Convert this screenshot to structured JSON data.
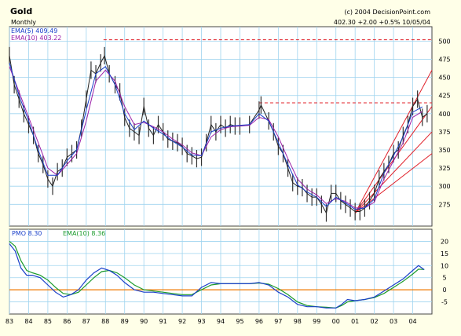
{
  "header": {
    "title": "Gold",
    "period": "Monthly",
    "copyright": "(c) 2004 DecisionPoint.com",
    "quote": "402.30 +2.00 +0.5% 10/05/04"
  },
  "chart_data": [
    {
      "type": "line",
      "name": "price-panel",
      "ylim": [
        245,
        520
      ],
      "yticks": [
        275,
        300,
        325,
        350,
        375,
        400,
        425,
        450,
        475,
        500
      ],
      "xlim": [
        1983.0,
        2005.0
      ],
      "legend": [
        {
          "label": "EMA(5) 409.49",
          "color": "#1a3fc9"
        },
        {
          "label": "EMA(10) 403.22",
          "color": "#9b1fa8"
        }
      ],
      "series": [
        {
          "name": "Gold",
          "color": "#222222",
          "x": [
            1983.0,
            1983.25,
            1983.5,
            1983.75,
            1984.0,
            1984.25,
            1984.5,
            1984.75,
            1985.0,
            1985.25,
            1985.5,
            1985.75,
            1986.0,
            1986.25,
            1986.5,
            1986.75,
            1987.0,
            1987.25,
            1987.5,
            1987.75,
            1987.95,
            1988.2,
            1988.5,
            1988.75,
            1989.0,
            1989.25,
            1989.5,
            1989.75,
            1990.0,
            1990.25,
            1990.5,
            1990.75,
            1991.0,
            1991.25,
            1991.5,
            1991.75,
            1992.0,
            1992.25,
            1992.5,
            1992.75,
            1993.0,
            1993.25,
            1993.5,
            1993.75,
            1994.0,
            1994.25,
            1994.5,
            1994.75,
            1995.0,
            1995.5,
            1996.0,
            1996.1,
            1996.5,
            1996.75,
            1997.0,
            1997.25,
            1997.5,
            1997.75,
            1998.0,
            1998.25,
            1998.5,
            1998.75,
            1999.0,
            1999.25,
            1999.5,
            1999.75,
            2000.0,
            2000.25,
            2000.5,
            2000.75,
            2001.0,
            2001.25,
            2001.5,
            2001.75,
            2002.0,
            2002.25,
            2002.5,
            2002.75,
            2003.0,
            2003.25,
            2003.5,
            2003.75,
            2004.0,
            2004.25,
            2004.5,
            2004.75
          ],
          "y": [
            480,
            440,
            420,
            400,
            385,
            370,
            345,
            330,
            310,
            300,
            320,
            325,
            340,
            345,
            350,
            380,
            420,
            460,
            455,
            470,
            480,
            455,
            440,
            430,
            395,
            380,
            375,
            370,
            410,
            380,
            370,
            385,
            375,
            365,
            362,
            360,
            355,
            345,
            342,
            338,
            340,
            360,
            385,
            375,
            385,
            380,
            385,
            383,
            383,
            385,
            405,
            412,
            390,
            375,
            355,
            345,
            325,
            305,
            300,
            298,
            290,
            285,
            285,
            275,
            263,
            290,
            290,
            280,
            275,
            270,
            265,
            265,
            270,
            280,
            290,
            310,
            320,
            330,
            345,
            350,
            370,
            385,
            410,
            420,
            395,
            400
          ]
        },
        {
          "name": "EMA(5)",
          "color": "#1a3fc9",
          "x": [
            1983.0,
            1983.5,
            1984.0,
            1984.5,
            1985.0,
            1985.5,
            1986.0,
            1986.5,
            1987.0,
            1987.5,
            1988.0,
            1988.5,
            1989.0,
            1989.5,
            1990.0,
            1990.5,
            1991.0,
            1991.5,
            1992.0,
            1992.5,
            1993.0,
            1993.5,
            1994.0,
            1994.5,
            1995.0,
            1995.5,
            1996.0,
            1996.5,
            1997.0,
            1997.5,
            1998.0,
            1998.5,
            1999.0,
            1999.5,
            2000.0,
            2000.5,
            2001.0,
            2001.5,
            2002.0,
            2002.5,
            2003.0,
            2003.5,
            2004.0,
            2004.5
          ],
          "y": [
            470,
            425,
            390,
            350,
            315,
            315,
            335,
            350,
            405,
            455,
            465,
            440,
            400,
            378,
            390,
            380,
            372,
            362,
            354,
            343,
            342,
            375,
            380,
            383,
            384,
            385,
            400,
            390,
            360,
            330,
            302,
            292,
            285,
            272,
            285,
            277,
            268,
            270,
            282,
            318,
            342,
            368,
            402,
            409.49
          ]
        },
        {
          "name": "EMA(10)",
          "color": "#9b1fa8",
          "x": [
            1983.0,
            1983.5,
            1984.0,
            1984.5,
            1985.0,
            1985.5,
            1986.0,
            1986.5,
            1987.0,
            1987.5,
            1988.0,
            1988.5,
            1989.0,
            1989.5,
            1990.0,
            1990.5,
            1991.0,
            1991.5,
            1992.0,
            1992.5,
            1993.0,
            1993.5,
            1994.0,
            1994.5,
            1995.0,
            1995.5,
            1996.0,
            1996.5,
            1997.0,
            1997.5,
            1998.0,
            1998.5,
            1999.0,
            1999.5,
            2000.0,
            2000.5,
            2001.0,
            2001.5,
            2002.0,
            2002.5,
            2003.0,
            2003.5,
            2004.0,
            2004.5
          ],
          "y": [
            465,
            430,
            395,
            360,
            325,
            315,
            330,
            345,
            390,
            445,
            460,
            445,
            410,
            385,
            388,
            382,
            375,
            365,
            357,
            346,
            342,
            368,
            378,
            382,
            383,
            384,
            395,
            392,
            368,
            338,
            310,
            296,
            288,
            276,
            283,
            279,
            270,
            270,
            278,
            310,
            335,
            360,
            395,
            403.22
          ]
        }
      ],
      "reference_lines": [
        {
          "kind": "horizontal-dashed",
          "color": "#e0202a",
          "y": 502,
          "x_from": 1987.9
        },
        {
          "kind": "horizontal-dashed",
          "color": "#e0202a",
          "y": 415,
          "x_from": 1996.0
        },
        {
          "kind": "trendline",
          "color": "#e0202a",
          "x": [
            2001.0,
            2005.0
          ],
          "y": [
            263,
            460
          ]
        },
        {
          "kind": "trendline",
          "color": "#e0202a",
          "x": [
            2001.0,
            2005.0
          ],
          "y": [
            263,
            410
          ]
        },
        {
          "kind": "trendline",
          "color": "#e0202a",
          "x": [
            2001.0,
            2005.0
          ],
          "y": [
            263,
            375
          ]
        },
        {
          "kind": "trendline",
          "color": "#e0202a",
          "x": [
            2001.0,
            2005.0
          ],
          "y": [
            263,
            345
          ]
        }
      ]
    },
    {
      "type": "line",
      "name": "pmo-panel",
      "ylim": [
        -10,
        25
      ],
      "yticks": [
        -5,
        0,
        5,
        10,
        15,
        20
      ],
      "zero_line_color": "#f07800",
      "xlim": [
        1983.0,
        2005.0
      ],
      "legend": [
        {
          "label": "PMO 8.30",
          "color": "#1a3fc9"
        },
        {
          "label": "EMA(10) 8.36",
          "color": "#1a9a2a"
        }
      ],
      "series": [
        {
          "name": "PMO",
          "color": "#1a3fc9",
          "x": [
            1983.0,
            1983.3,
            1983.6,
            1983.9,
            1984.2,
            1984.6,
            1985.0,
            1985.4,
            1985.8,
            1986.2,
            1986.6,
            1987.0,
            1987.4,
            1987.8,
            1988.2,
            1988.6,
            1989.0,
            1989.5,
            1990.0,
            1990.5,
            1991.0,
            1991.5,
            1992.0,
            1992.5,
            1993.0,
            1993.5,
            1994.0,
            1994.5,
            1995.0,
            1995.5,
            1996.0,
            1996.5,
            1997.0,
            1997.5,
            1998.0,
            1998.5,
            1999.0,
            1999.5,
            2000.0,
            2000.3,
            2000.6,
            2001.0,
            2001.5,
            2002.0,
            2002.5,
            2003.0,
            2003.5,
            2004.0,
            2004.3,
            2004.6
          ],
          "y": [
            19,
            16,
            9,
            6,
            6,
            5,
            2,
            -1,
            -3,
            -2,
            0,
            4,
            7,
            9,
            8,
            6,
            3,
            0,
            -1,
            -1,
            -1.5,
            -2,
            -2.5,
            -2.5,
            1,
            3,
            2.5,
            2.5,
            2.5,
            2.5,
            3,
            2,
            -1,
            -3,
            -6,
            -7,
            -7,
            -7.5,
            -7.5,
            -6,
            -4,
            -4.5,
            -4,
            -3,
            -0.5,
            2,
            4.5,
            8,
            10,
            8.3
          ]
        },
        {
          "name": "EMA(10)",
          "color": "#1a9a2a",
          "x": [
            1983.0,
            1983.3,
            1983.6,
            1983.9,
            1984.2,
            1984.6,
            1985.0,
            1985.4,
            1985.8,
            1986.2,
            1986.6,
            1987.0,
            1987.4,
            1987.8,
            1988.2,
            1988.6,
            1989.0,
            1989.5,
            1990.0,
            1990.5,
            1991.0,
            1991.5,
            1992.0,
            1992.5,
            1993.0,
            1993.5,
            1994.0,
            1994.5,
            1995.0,
            1995.5,
            1996.0,
            1996.5,
            1997.0,
            1997.5,
            1998.0,
            1998.5,
            1999.0,
            1999.5,
            2000.0,
            2000.3,
            2000.6,
            2001.0,
            2001.5,
            2002.0,
            2002.5,
            2003.0,
            2003.5,
            2004.0,
            2004.3,
            2004.6
          ],
          "y": [
            20,
            18,
            12,
            8,
            7,
            6,
            4,
            1,
            -1.5,
            -2,
            -1,
            2,
            5,
            7.5,
            8,
            7,
            5,
            2,
            0,
            -0.5,
            -1,
            -1.5,
            -2,
            -2,
            0,
            2,
            2.5,
            2.5,
            2.5,
            2.5,
            2.8,
            2.3,
            0.5,
            -2,
            -5,
            -6.5,
            -7,
            -7.2,
            -7.5,
            -6.5,
            -5,
            -4.5,
            -4,
            -3.2,
            -1.5,
            1,
            3.5,
            6.5,
            8.5,
            8.36
          ]
        }
      ]
    }
  ],
  "x_axis": {
    "tick_labels": [
      "83",
      "84",
      "85",
      "86",
      "87",
      "88",
      "89",
      "90",
      "91",
      "92",
      "93",
      "94",
      "95",
      "96",
      "97",
      "98",
      "99",
      "00",
      "01",
      "02",
      "03",
      "04"
    ],
    "tick_years": [
      1983,
      1984,
      1985,
      1986,
      1987,
      1988,
      1989,
      1990,
      1991,
      1992,
      1993,
      1994,
      1995,
      1996,
      1997,
      1998,
      1999,
      2000,
      2001,
      2002,
      2003,
      2004
    ]
  }
}
